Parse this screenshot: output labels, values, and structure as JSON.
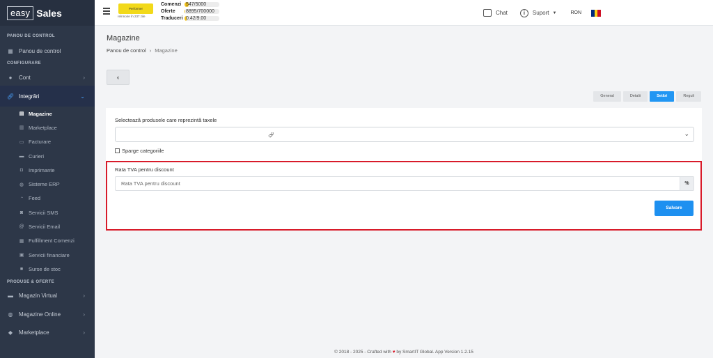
{
  "brand": {
    "easy": "easy",
    "sales": "Sales"
  },
  "sidebar": {
    "sections": [
      {
        "title": "PANOU DE CONTROL"
      },
      {
        "title": "CONFIGURARE"
      },
      {
        "title": "PRODUSE & OFERTE"
      }
    ],
    "dashboard": {
      "label": "Panou de control",
      "icon": "grid-icon"
    },
    "cont": {
      "label": "Cont",
      "icon": "user-icon"
    },
    "integrari": {
      "label": "Integrări",
      "icon": "link-icon"
    },
    "subitems": [
      {
        "label": "Magazine",
        "icon": "store-icon"
      },
      {
        "label": "Marketplace",
        "icon": "building-icon"
      },
      {
        "label": "Facturare",
        "icon": "invoice-icon"
      },
      {
        "label": "Curieri",
        "icon": "truck-icon"
      },
      {
        "label": "Imprimante",
        "icon": "printer-icon"
      },
      {
        "label": "Sisteme ERP",
        "icon": "globe-icon"
      },
      {
        "label": "Feed",
        "icon": "rss-icon"
      },
      {
        "label": "Servicii SMS",
        "icon": "sms-icon"
      },
      {
        "label": "Servicii Email",
        "icon": "at-icon"
      },
      {
        "label": "Fulfillment Comenzi",
        "icon": "grid-icon"
      },
      {
        "label": "Servicii financiare",
        "icon": "money-icon"
      },
      {
        "label": "Surse de stoc",
        "icon": "box-icon"
      }
    ],
    "magazin_virtual": {
      "label": "Magazin Virtual",
      "icon": "monitor-icon"
    },
    "magazine_online": {
      "label": "Magazine Online",
      "icon": "globe-icon"
    },
    "marketplace": {
      "label": "Marketplace",
      "icon": "tag-icon"
    }
  },
  "topbar": {
    "badge": "Performer",
    "badge_sub": "reînnoire în 237 zile",
    "stats": [
      {
        "label": "Comenzi",
        "value": "547/5000",
        "fill": 0.11
      },
      {
        "label": "Oferte",
        "value": "8895/700000",
        "fill": 0.02
      },
      {
        "label": "Traduceri",
        "value": "0.42/9.00",
        "fill": 0.05
      }
    ],
    "chat": "Chat",
    "suport": "Suport",
    "currency": "RON",
    "flag_colors": [
      "#002b7f",
      "#fcd116",
      "#ce1126"
    ]
  },
  "page": {
    "title": "Magazine",
    "breadcrumb_home": "Panou de control",
    "breadcrumb_current": "Magazine",
    "back": "‹"
  },
  "tabs": [
    "General",
    "Detalii",
    "Setări",
    "Reguli"
  ],
  "tab_active": "Setări",
  "form": {
    "tax_products_label": "Selectează produsele care reprezintă taxele",
    "split_categories": "Sparge categoriile",
    "vat_label": "Rata TVA pentru discount",
    "vat_placeholder": "Rata TVA pentru discount",
    "vat_suffix": "%",
    "save": "Salvare"
  },
  "footer": {
    "prefix": "© 2018 - 2025 - Crafted with",
    "heart": "♥",
    "suffix": "by SmartIT Global. App Version 1.2.15"
  },
  "colors": {
    "accent": "#2196f3",
    "sidebar": "#2d3748",
    "highlight": "#d81b2a"
  }
}
